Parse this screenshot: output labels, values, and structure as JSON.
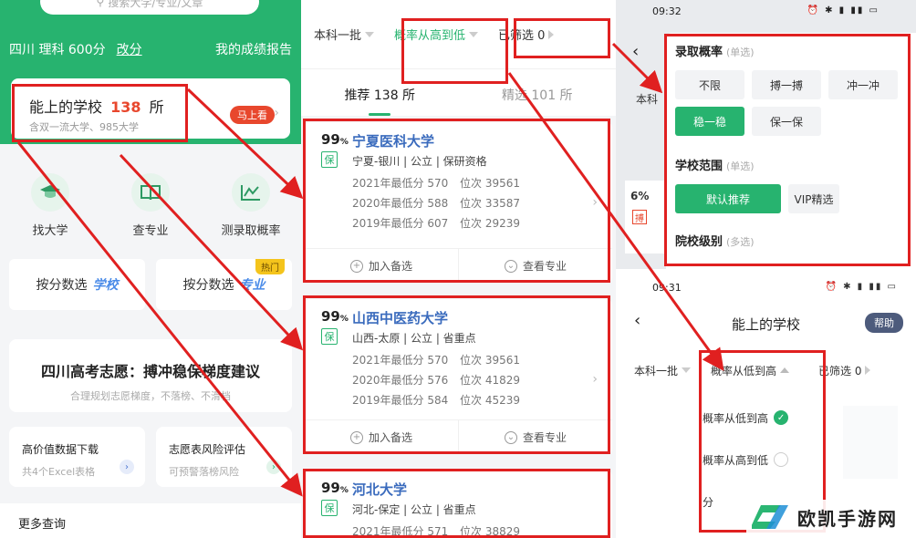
{
  "panel1": {
    "search_placeholder": "搜索大学/专业/文章",
    "score_info": "四川 理科 600分",
    "edit_label": "改分",
    "report_label": "我的成绩报告",
    "card": {
      "title_prefix": "能上的学校",
      "count": "138",
      "title_suffix": "所",
      "subtitle": "含双一流大学、985大学",
      "go_label": "马上看"
    },
    "icons": [
      {
        "icon": "graduation-cap-icon",
        "label": "找大学"
      },
      {
        "icon": "open-book-icon",
        "label": "查专业"
      },
      {
        "icon": "line-chart-icon",
        "label": "测录取概率"
      }
    ],
    "filter_buttons": [
      {
        "label": "按分数选",
        "emphasis": "学校",
        "tag": ""
      },
      {
        "label": "按分数选",
        "emphasis": "专业",
        "tag": "热门"
      }
    ],
    "banner": {
      "title": "四川高考志愿：搏冲稳保梯度建议",
      "subtitle": "合理规划志愿梯度，不落榜、不滑档"
    },
    "tiles": [
      {
        "title": "高价值数据下载",
        "subtitle": "共4个Excel表格"
      },
      {
        "title": "志愿表风险评估",
        "subtitle": "可预警落榜风险"
      }
    ],
    "more_label": "更多查询"
  },
  "panel2": {
    "sort_bar": {
      "batch": "本科一批",
      "sort": "概率从高到低",
      "filter": "已筛选 0"
    },
    "tabs": [
      {
        "label": "推荐 138 所"
      },
      {
        "label": "精选 101 所"
      }
    ],
    "score_label": "最低分",
    "rank_label": "位次",
    "add_label": "加入备选",
    "view_label": "查看专业",
    "schools": [
      {
        "probability": "99",
        "unit": "%",
        "badge": "保",
        "name": "宁夏医科大学",
        "meta": "宁夏-银川 | 公立 | 保研资格",
        "rows": [
          {
            "year": "2021年最低分",
            "score": "570",
            "rank": "39561"
          },
          {
            "year": "2020年最低分",
            "score": "588",
            "rank": "33587"
          },
          {
            "year": "2019年最低分",
            "score": "607",
            "rank": "29239"
          }
        ]
      },
      {
        "probability": "99",
        "unit": "%",
        "badge": "保",
        "name": "山西中医药大学",
        "meta": "山西-太原 | 公立 | 省重点",
        "rows": [
          {
            "year": "2021年最低分",
            "score": "570",
            "rank": "39561"
          },
          {
            "year": "2020年最低分",
            "score": "576",
            "rank": "41829"
          },
          {
            "year": "2019年最低分",
            "score": "584",
            "rank": "45239"
          }
        ]
      },
      {
        "probability": "99",
        "unit": "%",
        "badge": "保",
        "name": "河北大学",
        "meta": "河北-保定 | 公立 | 省重点",
        "rows": [
          {
            "year": "2021年最低分",
            "score": "571",
            "rank": "38829"
          }
        ]
      }
    ]
  },
  "panel3": {
    "status_time_top": "09:32",
    "behind_batch": "本科",
    "behind_prob": "6%",
    "behind_badge": "搏",
    "filter": {
      "section1": "录取概率",
      "section1_note": "(单选)",
      "section1_options": [
        "不限",
        "搏一搏",
        "冲一冲",
        "稳一稳",
        "保一保"
      ],
      "section1_selected": "稳一稳",
      "section2": "学校范围",
      "section2_note": "(单选)",
      "section2_options": [
        "默认推荐",
        "VIP精选"
      ],
      "section2_selected": "默认推荐",
      "section3": "院校级别",
      "section3_note": "(多选)"
    },
    "status_time_bottom": "09:31",
    "title": "能上的学校",
    "help_label": "帮助",
    "sort_bar": {
      "batch": "本科一批",
      "sort": "概率从低到高",
      "filter": "已筛选 0"
    },
    "dropdown": [
      {
        "label": "概率从低到高",
        "selected": true
      },
      {
        "label": "概率从高到低",
        "selected": false
      },
      {
        "label": "分",
        "selected": false
      }
    ]
  },
  "watermark": {
    "text": "欧凯手游网"
  },
  "colors": {
    "brand_green": "#27b36f",
    "highlight_red": "#e02020",
    "link_blue": "#3a6bbd",
    "count_red": "#e8472d"
  }
}
